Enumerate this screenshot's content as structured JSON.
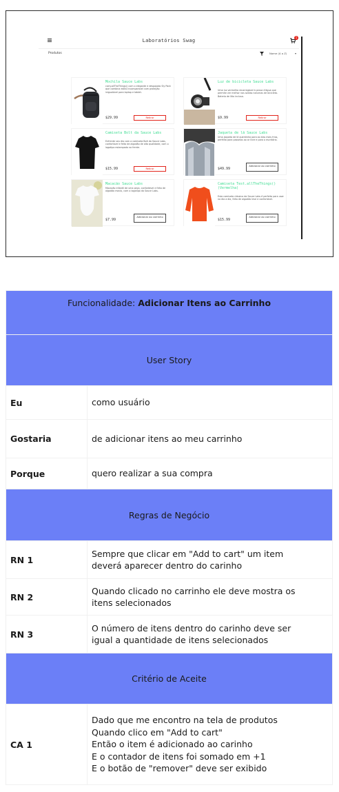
{
  "app": {
    "title": "Laboratórios Swag",
    "cart_count": "1",
    "page_label": "Produtos",
    "sort_selected": "Nome (A a Z)"
  },
  "products": [
    {
      "name": "Mochila Sauce Labs",
      "description": "carry.allTheThings() com o elegante e despojado Sly Pack que combina estilo incomparável com proteção inigualável para laptop e tablet.",
      "price": "$29.99",
      "button": "Retirar"
    },
    {
      "name": "Luz de bicicleta Sauce Labs",
      "description": "Uma luz vermelha recarregável à prova d'água que permite ver melhor nas saídas noturnas de bicicleta. Bateria de lítio inclusa.",
      "price": "$9.99",
      "button": "Retirar"
    },
    {
      "name": "Camiseta Bolt da Sauce Labs",
      "description": "Enfrente seu dia com a camiseta Bolt da Sauce Labs, confortável e feita de algodão de alta qualidade, com o logotipo estampado na frente.",
      "price": "$15.99",
      "button": "Retirar"
    },
    {
      "name": "Jaqueta de lã Sauce Labs",
      "description": "Uma jaqueta de lã quentinha para os dias mais frios, perfeita para passeios ao ar livre e para o escritório.",
      "price": "$49.99",
      "button": "Adicionar ao carrinho"
    },
    {
      "name": "Macacão Sauce Labs",
      "description": "Macacão infantil de uma peça, confortável e feito de algodão macio, com o logotipo da Sauce Labs.",
      "price": "$7.99",
      "button": "Adicionar ao carrinho"
    },
    {
      "name": "Camiseta Test.allTheThings() (Vermelha)",
      "description": "Esta camiseta clássica da Sauce Labs é perfeita para usar no dia a dia, feita de algodão leve e confortável.",
      "price": "$15.99",
      "button": "Adicionar ao carrinho"
    }
  ],
  "doc": {
    "feature_prefix": "Funcionalidade: ",
    "feature_name": "Adicionar Itens ao Carrinho",
    "user_story_title": "User Story",
    "story": [
      {
        "label": "Eu",
        "value": "como usuário"
      },
      {
        "label": "Gostaria",
        "value": "de adicionar itens ao meu carrinho"
      },
      {
        "label": "Porque",
        "value": "quero realizar a sua compra"
      }
    ],
    "rules_title": "Regras de Negócio",
    "rules": [
      {
        "label": "RN 1",
        "lines": [
          "Sempre que clicar em \"Add to cart\" um item",
          "deverá aparecer dentro do carinho"
        ]
      },
      {
        "label": "RN 2",
        "lines": [
          "Quando clicado no carrinho ele deve mostra os",
          "itens selecionados"
        ]
      },
      {
        "label": "RN 3",
        "lines": [
          "O número de itens dentro do carinho deve ser",
          "igual a quantidade de itens selecionados"
        ]
      }
    ],
    "acceptance_title": "Critério de Aceite",
    "acceptance": {
      "label": "CA 1",
      "lines": [
        "Dado que me encontro na tela de produtos",
        "Quando clico em \"Add to cart\"",
        "Então o item é adicionado ao carinho",
        "E o contador de itens foi somado em +1",
        "E o botão de \"remover\" deve ser exibido"
      ]
    }
  }
}
